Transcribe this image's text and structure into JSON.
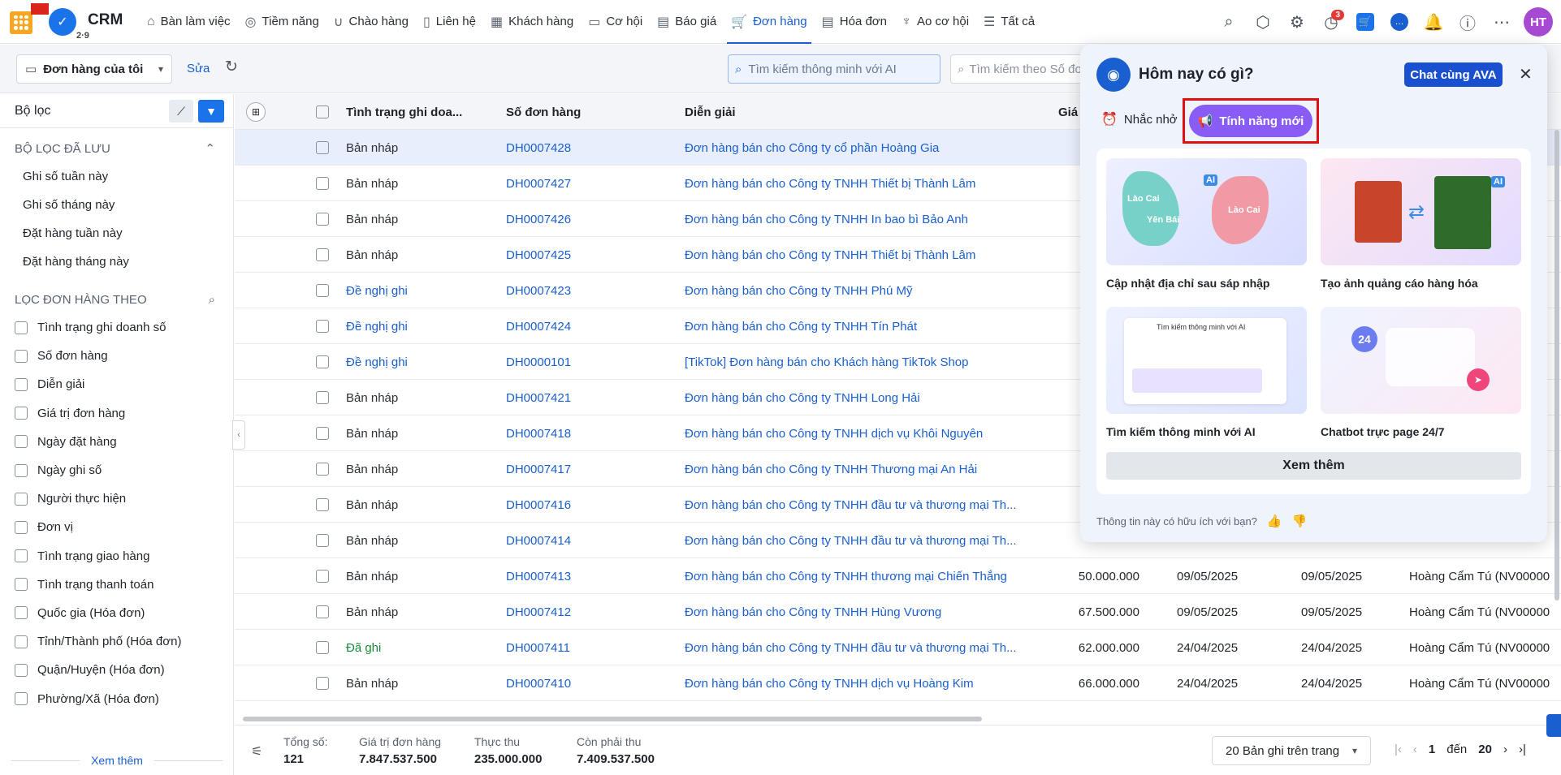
{
  "app": {
    "name": "CRM",
    "sub": "2·9"
  },
  "nav": [
    {
      "label": "Bàn làm việc",
      "icon": "home-icon"
    },
    {
      "label": "Tiềm năng",
      "icon": "person-icon"
    },
    {
      "label": "Chào hàng",
      "icon": "magnet-icon"
    },
    {
      "label": "Liên hệ",
      "icon": "contact-icon"
    },
    {
      "label": "Khách hàng",
      "icon": "building-icon"
    },
    {
      "label": "Cơ hội",
      "icon": "briefcase-icon"
    },
    {
      "label": "Báo giá",
      "icon": "quote-icon"
    },
    {
      "label": "Đơn hàng",
      "icon": "cart-icon",
      "active": true
    },
    {
      "label": "Hóa đơn",
      "icon": "invoice-icon"
    },
    {
      "label": "Ao cơ hội",
      "icon": "pool-icon"
    },
    {
      "label": "Tất cả",
      "icon": "menu-icon"
    }
  ],
  "topbar": {
    "notif_count": "3",
    "avatar": "HT"
  },
  "toolbar": {
    "view": "Đơn hàng của tôi",
    "edit": "Sửa",
    "search_ai_placeholder": "Tìm kiếm thông minh với AI",
    "search_placeholder": "Tìm kiếm theo Số đơn hàng"
  },
  "sidebar": {
    "title": "Bộ lọc",
    "saved_title": "BỘ LỌC ĐÃ LƯU",
    "saved": [
      "Ghi số tuần này",
      "Ghi số tháng này",
      "Đặt hàng tuần này",
      "Đặt hàng tháng này"
    ],
    "filter_title": "LỌC ĐƠN HÀNG THEO",
    "filters": [
      "Tình trạng ghi doanh số",
      "Số đơn hàng",
      "Diễn giải",
      "Giá trị đơn hàng",
      "Ngày đặt hàng",
      "Ngày ghi số",
      "Người thực hiện",
      "Đơn vị",
      "Tình trạng giao hàng",
      "Tình trạng thanh toán",
      "Quốc gia (Hóa đơn)",
      "Tỉnh/Thành phố (Hóa đơn)",
      "Quận/Huyện (Hóa đơn)",
      "Phường/Xã (Hóa đơn)"
    ],
    "more": "Xem thêm"
  },
  "table": {
    "headers": {
      "status": "Tình trạng ghi doa...",
      "no": "Số đơn hàng",
      "desc": "Diễn giải",
      "value": "Giá"
    },
    "rows": [
      {
        "status": "Bản nháp",
        "kind": "draft",
        "no": "DH0007428",
        "desc": "Đơn hàng bán cho Công ty cổ phần Hoàng Gia",
        "value": "",
        "d1": "",
        "d2": "",
        "person": "",
        "selected": true
      },
      {
        "status": "Bản nháp",
        "kind": "draft",
        "no": "DH0007427",
        "desc": "Đơn hàng bán cho Công ty TNHH Thiết bị Thành Lâm",
        "value": "",
        "d1": "",
        "d2": "",
        "person": ""
      },
      {
        "status": "Bản nháp",
        "kind": "draft",
        "no": "DH0007426",
        "desc": "Đơn hàng bán cho Công ty TNHH In bao bì Bảo Anh",
        "value": "",
        "d1": "",
        "d2": "",
        "person": ""
      },
      {
        "status": "Bản nháp",
        "kind": "draft",
        "no": "DH0007425",
        "desc": "Đơn hàng bán cho Công ty TNHH Thiết bị Thành Lâm",
        "value": "",
        "d1": "",
        "d2": "",
        "person": ""
      },
      {
        "status": "Đề nghị ghi",
        "kind": "prop",
        "no": "DH0007423",
        "desc": "Đơn hàng bán cho Công ty TNHH Phú Mỹ",
        "value": "",
        "d1": "",
        "d2": "",
        "person": ""
      },
      {
        "status": "Đề nghị ghi",
        "kind": "prop",
        "no": "DH0007424",
        "desc": "Đơn hàng bán cho Công ty TNHH Tín Phát",
        "value": "",
        "d1": "",
        "d2": "",
        "person": ""
      },
      {
        "status": "Đề nghị ghi",
        "kind": "prop",
        "no": "DH0000101",
        "desc": "[TikTok] Đơn hàng bán cho Khách hàng TikTok Shop",
        "value": "",
        "d1": "",
        "d2": "",
        "person": ""
      },
      {
        "status": "Bản nháp",
        "kind": "draft",
        "no": "DH0007421",
        "desc": "Đơn hàng bán cho Công ty TNHH Long Hải",
        "value": "",
        "d1": "",
        "d2": "",
        "person": ""
      },
      {
        "status": "Bản nháp",
        "kind": "draft",
        "no": "DH0007418",
        "desc": "Đơn hàng bán cho Công ty TNHH dịch vụ Khôi Nguyên",
        "value": "",
        "d1": "",
        "d2": "",
        "person": ""
      },
      {
        "status": "Bản nháp",
        "kind": "draft",
        "no": "DH0007417",
        "desc": "Đơn hàng bán cho Công ty TNHH Thương mại An Hải",
        "value": "",
        "d1": "",
        "d2": "",
        "person": ""
      },
      {
        "status": "Bản nháp",
        "kind": "draft",
        "no": "DH0007416",
        "desc": "Đơn hàng bán cho Công ty TNHH đầu tư và thương mại Th...",
        "value": "",
        "d1": "",
        "d2": "",
        "person": ""
      },
      {
        "status": "Bản nháp",
        "kind": "draft",
        "no": "DH0007414",
        "desc": "Đơn hàng bán cho Công ty TNHH đầu tư và thương mại Th...",
        "value": "",
        "d1": "",
        "d2": "",
        "person": ""
      },
      {
        "status": "Bản nháp",
        "kind": "draft",
        "no": "DH0007413",
        "desc": "Đơn hàng bán cho Công ty TNHH thương mại Chiến Thắng",
        "value": "50.000.000",
        "d1": "09/05/2025",
        "d2": "09/05/2025",
        "person": "Hoàng Cẩm Tú (NV00000"
      },
      {
        "status": "Bản nháp",
        "kind": "draft",
        "no": "DH0007412",
        "desc": "Đơn hàng bán cho Công ty TNHH Hùng Vương",
        "value": "67.500.000",
        "d1": "09/05/2025",
        "d2": "09/05/2025",
        "person": "Hoàng Cẩm Tú (NV00000"
      },
      {
        "status": "Đã ghi",
        "kind": "done",
        "no": "DH0007411",
        "desc": "Đơn hàng bán cho Công ty TNHH đầu tư và thương mại Th...",
        "value": "62.000.000",
        "d1": "24/04/2025",
        "d2": "24/04/2025",
        "person": "Hoàng Cẩm Tú (NV00000"
      },
      {
        "status": "Bản nháp",
        "kind": "draft",
        "no": "DH0007410",
        "desc": "Đơn hàng bán cho Công ty TNHH dịch vụ Hoàng Kim",
        "value": "66.000.000",
        "d1": "24/04/2025",
        "d2": "24/04/2025",
        "person": "Hoàng Cẩm Tú (NV00000"
      }
    ]
  },
  "footer": {
    "total_label": "Tổng số:",
    "total": "121",
    "order_value_label": "Giá trị đơn hàng",
    "order_value": "7.847.537.500",
    "paid_label": "Thực thu",
    "paid": "235.000.000",
    "remaining_label": "Còn phải thu",
    "remaining": "7.409.537.500",
    "page_size": "20 Bản ghi trên trang",
    "page": "1",
    "page_to": "đến",
    "page_max": "20"
  },
  "panel": {
    "title": "Hôm nay có gì?",
    "chat_btn": "Chat cùng AVA",
    "tab_reminder": "Nhắc nhở",
    "tab_new": "Tính năng mới",
    "cards": [
      {
        "caption": "Cập nhật địa chỉ sau sáp nhập",
        "img": {
          "a": "Lào Cai",
          "b": "Yên Bái",
          "c": "Lào Cai",
          "ai": "AI"
        }
      },
      {
        "caption": "Tạo ảnh quảng cáo hàng hóa",
        "img": {
          "ai": "AI"
        }
      },
      {
        "caption": "Tìm kiếm thông minh với AI",
        "img": {
          "search": "Tìm kiếm thông minh với AI"
        }
      },
      {
        "caption": "Chatbot trực page 24/7",
        "img": {
          "num": "24"
        }
      }
    ],
    "more": "Xem thêm",
    "feedback": "Thông tin này có hữu ích với bạn?"
  }
}
